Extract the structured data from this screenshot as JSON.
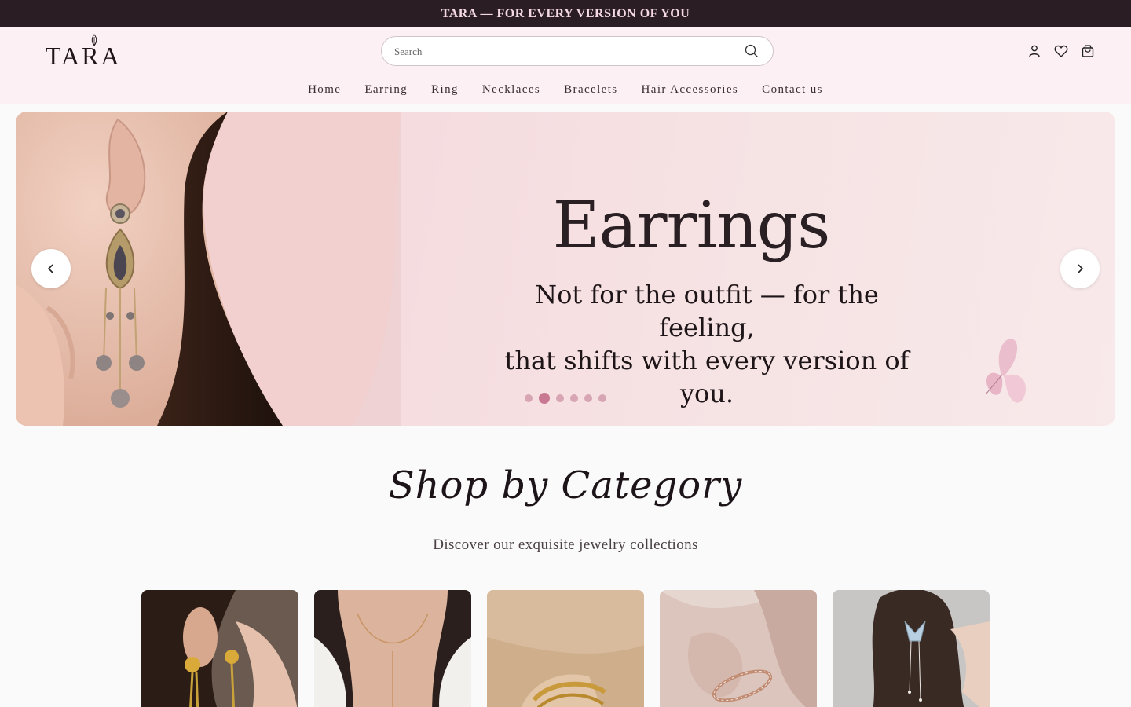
{
  "announcement": "TARA — FOR EVERY VERSION OF YOU",
  "brand": {
    "logo_text": "TARA"
  },
  "search": {
    "placeholder": "Search"
  },
  "header_icons": [
    "account-icon",
    "wishlist-heart-icon",
    "cart-bag-icon"
  ],
  "nav": {
    "items": [
      {
        "label": "Home"
      },
      {
        "label": "Earring"
      },
      {
        "label": "Ring"
      },
      {
        "label": "Necklaces"
      },
      {
        "label": "Bracelets"
      },
      {
        "label": "Hair Accessories"
      },
      {
        "label": "Contact us"
      }
    ]
  },
  "hero": {
    "title": "Earrings",
    "subtitle_line1": "Not for the outfit — for the feeling,",
    "subtitle_line2": "that shifts with every version of you.",
    "slide_count": 6,
    "active_slide": 2
  },
  "categories": {
    "title": "Shop by Category",
    "subtitle": "Discover our exquisite jewelry collections",
    "cards": [
      "earrings-card",
      "necklaces-card",
      "bracelets-card",
      "rings-card",
      "hair-accessories-card"
    ]
  },
  "colors": {
    "announcement_bg": "#2b1d24",
    "header_bg": "#fcf0f4",
    "accent_pink": "#c97891"
  }
}
